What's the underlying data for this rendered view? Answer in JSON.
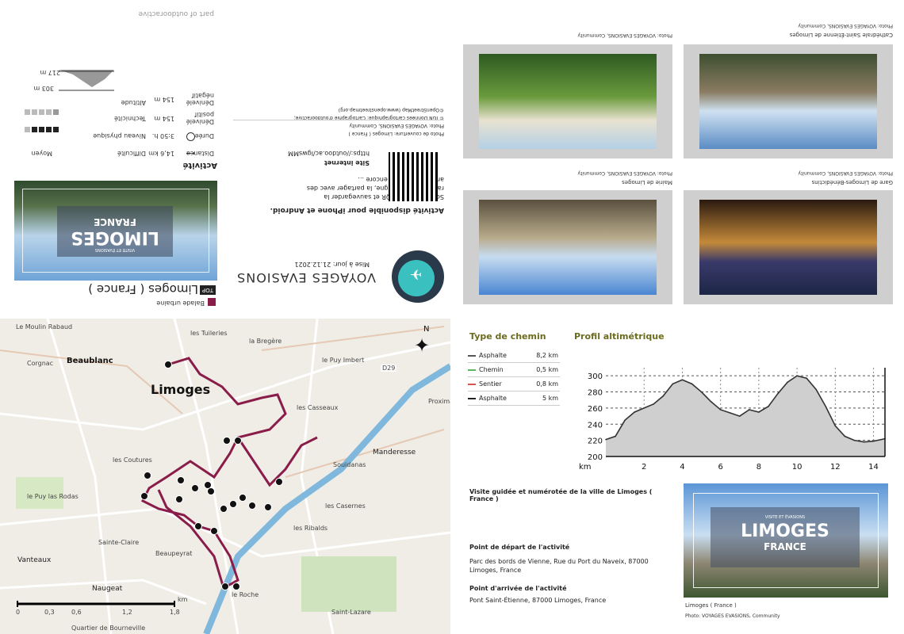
{
  "brand": {
    "part_of": "part of outdooractive",
    "name": "VOYAGES EVASIONS",
    "updated": "Mise à jour: 21.12.2021"
  },
  "header": {
    "category": "Balade urbaine",
    "top_badge": "TOP",
    "title": "Limoges ( France )"
  },
  "hero_card": {
    "line_small": "VISITE ET ÉVASIONS",
    "city": "LIMOGES",
    "country": "FRANCE"
  },
  "activity": {
    "title": "Activité",
    "rows": [
      {
        "label": "Difficulté",
        "value": "Moyen"
      },
      {
        "label": "Distance",
        "value": "14,6 km"
      },
      {
        "label": "Niveau physique",
        "value": ""
      },
      {
        "label": "Durée",
        "value": "3:50 h."
      },
      {
        "label": "Technicité",
        "value": ""
      },
      {
        "label": "Dénivelé positif",
        "value": "154 m"
      },
      {
        "label": "Dénivelé négatif",
        "value": "154 m"
      },
      {
        "label": "Altitude",
        "value": ""
      }
    ],
    "alt_max": "303 m",
    "alt_min": "217 m"
  },
  "app_block": {
    "title": "Activité disponible pour iPhone et Android.",
    "text": "Scanner le code QR et sauvegarder la randonnée hors-ligne, la partager avec des amis et bien plus encore ...",
    "site_label": "Site internet",
    "site_url": "https://outdoo.ac/lgwsMM",
    "credits1": "Photo de couverture: Limoges ( France )",
    "credits2": "Photo: VOYAGES EVASIONS, Community",
    "credits3": "© IGN Données cartographique: Cartographie d'outdooractive;",
    "credits4": "©OpenStreetMap (www.openstreetmap.org)"
  },
  "photos": [
    {
      "caption": "Cathédrale Saint-Étienne de Limoges",
      "credit": "Photo: VOYAGES EVASIONS, Community"
    },
    {
      "caption": "",
      "credit": "Photo: VOYAGES EVASIONS, Community"
    },
    {
      "caption": "Gare de Limoges-Bénédictins",
      "credit": "Photo: VOYAGES EVASIONS, Community"
    },
    {
      "caption": "Mairie de Limoges",
      "credit": "Photo: VOYAGES EVASIONS, Community"
    }
  ],
  "map": {
    "city_label": "Limoges",
    "places": [
      "Le Moulin Rabaud",
      "les Tuileries",
      "Corgnac",
      "Beaublanc",
      "la Bregère",
      "le Puy Imbert",
      "les Casseaux",
      "Proximat",
      "Souidanas",
      "Manderesse",
      "les Coutures",
      "le Puy las Rodas",
      "les Casernes",
      "Beaupeyrat",
      "Sainte-Claire",
      "Vanteaux",
      "Naugeat",
      "le Roche",
      "Saint-Lazare",
      "les Ribalds",
      "Quartier de Bourneville",
      "D29"
    ],
    "scale": [
      "0",
      "0,3",
      "0,6",
      "1,2",
      "1,8"
    ],
    "scale_unit": "km",
    "north": "N"
  },
  "surface": {
    "title": "Type de chemin",
    "rows": [
      {
        "name": "Asphalte",
        "value": "8,2 km",
        "color": "#555555"
      },
      {
        "name": "Chemin",
        "value": "0,5 km",
        "color": "#5cb85c"
      },
      {
        "name": "Sentier",
        "value": "0,8 km",
        "color": "#d9534f"
      },
      {
        "name": "Asphalte",
        "value": "5 km",
        "color": "#222222"
      }
    ]
  },
  "chart_data": {
    "type": "area",
    "title": "Profil altimétrique",
    "xlabel": "km",
    "ylabel": "",
    "xlim": [
      0,
      14.6
    ],
    "ylim": [
      200,
      310
    ],
    "xticks": [
      2,
      4,
      6,
      8,
      10,
      12,
      14
    ],
    "yticks": [
      200,
      220,
      240,
      260,
      280,
      300
    ],
    "grid": true,
    "x": [
      0,
      0.5,
      1,
      1.5,
      2,
      2.5,
      3,
      3.5,
      4,
      4.5,
      5,
      5.5,
      6,
      6.5,
      7,
      7.5,
      8,
      8.5,
      9,
      9.5,
      10,
      10.5,
      11,
      11.5,
      12,
      12.5,
      13,
      13.5,
      14,
      14.6
    ],
    "y": [
      221,
      225,
      245,
      255,
      260,
      265,
      275,
      290,
      295,
      290,
      280,
      268,
      258,
      254,
      250,
      258,
      255,
      262,
      278,
      292,
      300,
      297,
      283,
      262,
      238,
      225,
      220,
      218,
      219,
      222
    ]
  },
  "info": {
    "tour_title": "Visite guidée et numérotée de la ville de Limoges ( France )",
    "start_title": "Point de départ de l'activité",
    "start_text": "Parc des bords de Vienne, Rue du Port du Naveix, 87000 Limoges, France",
    "end_title": "Point d'arrivée de l'activité",
    "end_text": "Pont Saint-Étienne, 87000 Limoges, France",
    "photo_caption": "Limoges ( France )",
    "photo_credit": "Photo: VOYAGES EVASIONS, Community",
    "photo_small": "VISITE ET ÉVASIONS",
    "photo_city": "LIMOGES",
    "photo_country": "FRANCE"
  }
}
